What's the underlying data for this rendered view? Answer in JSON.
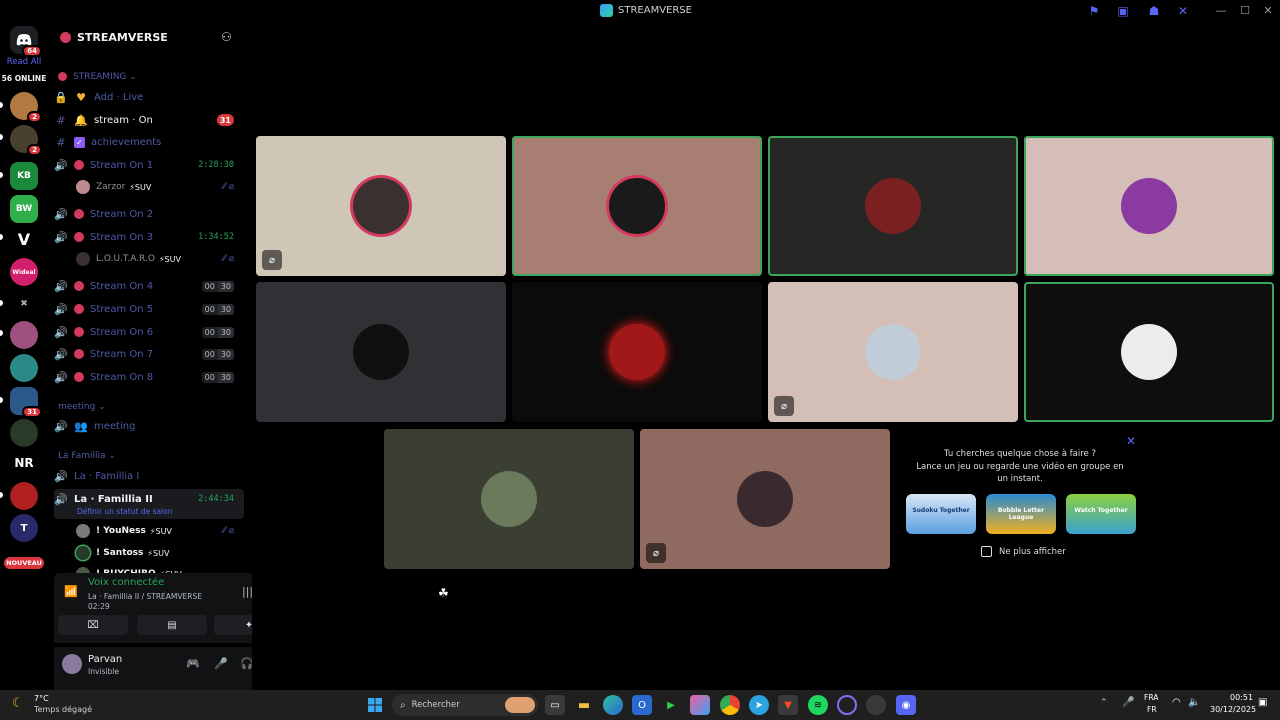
{
  "window": {
    "title": "STREAMVERSE",
    "titlebar_icons": [
      "flag-icon",
      "inbox-icon",
      "alien-icon",
      "tools-icon"
    ],
    "controls": [
      "minimize",
      "maximize",
      "close"
    ]
  },
  "rail": {
    "dm_badge": "64",
    "read_all": "Read All",
    "online": "56 ONLINE",
    "servers": [
      {
        "label": "",
        "color": "#b07a40",
        "badge": "2"
      },
      {
        "label": "",
        "color": "#4a4030",
        "badge": "2"
      },
      {
        "label": "KB",
        "color": "#1a8a3a",
        "badge": ""
      },
      {
        "label": "BW",
        "color": "#2fae4a",
        "badge": ""
      },
      {
        "label": "V",
        "color": "#000000",
        "badge": ""
      },
      {
        "label": "Wideal",
        "color": "#d21f6b",
        "badge": ""
      },
      {
        "label": "✖",
        "color": "#000000",
        "badge": ""
      },
      {
        "label": "",
        "color": "#a05080",
        "badge": ""
      },
      {
        "label": "",
        "color": "#2a8a8a",
        "badge": ""
      },
      {
        "label": "",
        "color": "#2a5a8a",
        "badge": "31"
      },
      {
        "label": "",
        "color": "#2a3a2a",
        "badge": ""
      },
      {
        "label": "NR",
        "color": "#000000",
        "badge": ""
      },
      {
        "label": "",
        "color": "#b02020",
        "badge": ""
      },
      {
        "label": "T",
        "color": "#2a2a6a",
        "badge": ""
      }
    ],
    "new_label": "NOUVEAU"
  },
  "sidebar": {
    "guild_name": "STREAMVERSE",
    "category_streaming": "STREAMING",
    "add_live": "Add · Live",
    "stream_on": "stream · On",
    "stream_on_badge": "31",
    "achievements": "achievements",
    "voice_channels": [
      {
        "label": "Stream On 1",
        "time": "2:28:30"
      },
      {
        "label": "Stream On 2",
        "time": ""
      },
      {
        "label": "Stream On 3",
        "time": "1:34:52"
      },
      {
        "label": "Stream On 4",
        "count_a": "00",
        "count_b": "30"
      },
      {
        "label": "Stream On 5",
        "count_a": "00",
        "count_b": "30"
      },
      {
        "label": "Stream On 6",
        "count_a": "00",
        "count_b": "30"
      },
      {
        "label": "Stream On 7",
        "count_a": "00",
        "count_b": "30"
      },
      {
        "label": "Stream On 8",
        "count_a": "00",
        "count_b": "30"
      }
    ],
    "users_stream1": [
      {
        "name": "Zarzor",
        "tag": "⚡SUV"
      }
    ],
    "users_stream3": [
      {
        "name": "L.O.U.T.A.R.O",
        "tag": "⚡SUV"
      }
    ],
    "category_meeting": "meeting",
    "meeting_channel": "meeting",
    "category_famillia": "La Famillia",
    "famillia_1": "La · Famillia I",
    "famillia_2": "La · Famillia II",
    "famillia_2_time": "2:44:34",
    "status_prompt": "Définir un statut de salon",
    "users_famillia2": [
      {
        "name": "! YouNess",
        "tag": "⚡SUV"
      },
      {
        "name": "! Santoss",
        "tag": "⚡SUV"
      },
      {
        "name": "! BUYCHIRO",
        "tag": "⚡SUV"
      }
    ]
  },
  "voice": {
    "status": "Voix connectée",
    "channel": "La · Famillia II / STREAMVERSE",
    "elapsed": "02:29"
  },
  "user": {
    "name": "Parvan",
    "status": "Invisible"
  },
  "activity": {
    "line1": "Tu cherches quelque chose à faire ?",
    "line2": "Lance un jeu ou regarde une vidéo en groupe en un instant.",
    "games": [
      "Sudoku Together",
      "Bobble Letter League",
      "Watch Together"
    ],
    "dont_show": "Ne plus afficher"
  },
  "tiles": [
    {
      "name": "tile-1",
      "bg": "#cfc6b8",
      "avatar": "#3a3030",
      "speaking": false,
      "muted": true
    },
    {
      "name": "tile-2",
      "bg": "#a87e72",
      "avatar": "#1a1a1a",
      "speaking": true,
      "muted": false
    },
    {
      "name": "tile-3",
      "bg": "#262725",
      "avatar": "#7a2020",
      "speaking": true,
      "muted": false
    },
    {
      "name": "tile-4",
      "bg": "#d5beb8",
      "avatar": "#8a3aa0",
      "speaking": true,
      "muted": false
    },
    {
      "name": "tile-5",
      "bg": "#323034",
      "avatar": "#101010",
      "speaking": false,
      "muted": false
    },
    {
      "name": "tile-6",
      "bg": "#0b0b0b",
      "avatar": "#a01818",
      "speaking": false,
      "muted": false
    },
    {
      "name": "tile-7",
      "bg": "#d4bfb6",
      "avatar": "#c0ccd8",
      "speaking": false,
      "muted": true
    },
    {
      "name": "tile-8",
      "bg": "#0e0e0e",
      "avatar": "#ececec",
      "speaking": true,
      "muted": false
    },
    {
      "name": "tile-9",
      "bg": "#3b3f33",
      "avatar": "#6a7a5a",
      "speaking": false,
      "muted": false
    },
    {
      "name": "tile-10",
      "bg": "#8e6a60",
      "avatar": "#3a2a30",
      "speaking": false,
      "muted": true
    }
  ],
  "taskbar": {
    "weather_temp": "7°C",
    "weather_desc": "Temps dégagé",
    "search": "Rechercher",
    "lang1": "FRA",
    "lang2": "FR",
    "time": "00:51",
    "date": "30/12/2025"
  }
}
